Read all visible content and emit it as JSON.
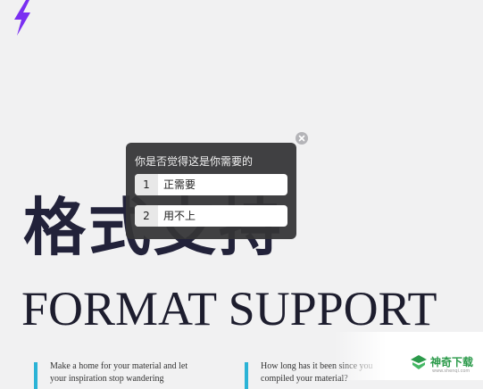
{
  "header": {
    "logo_icon": "lightning-bolt-icon",
    "logo_color": "#7a2ff2"
  },
  "hero": {
    "title_cn": "格式支持",
    "title_en": "FORMAT SUPPORT"
  },
  "columns": [
    {
      "line1": "Make a home for your material and let",
      "line2": "your inspiration stop wandering"
    },
    {
      "line1": "How long has it been since you",
      "line2": "compiled your material?"
    }
  ],
  "accent_color": "#2bb3d6",
  "survey_popup": {
    "question": "你是否觉得这是你需要的",
    "options": [
      {
        "num": "1",
        "label": "正需要"
      },
      {
        "num": "2",
        "label": "用不上"
      }
    ],
    "close_icon": "close-icon"
  },
  "watermark": {
    "text": "神奇下载",
    "sub": "www.shenqi.com",
    "color": "#2b9a4a"
  }
}
